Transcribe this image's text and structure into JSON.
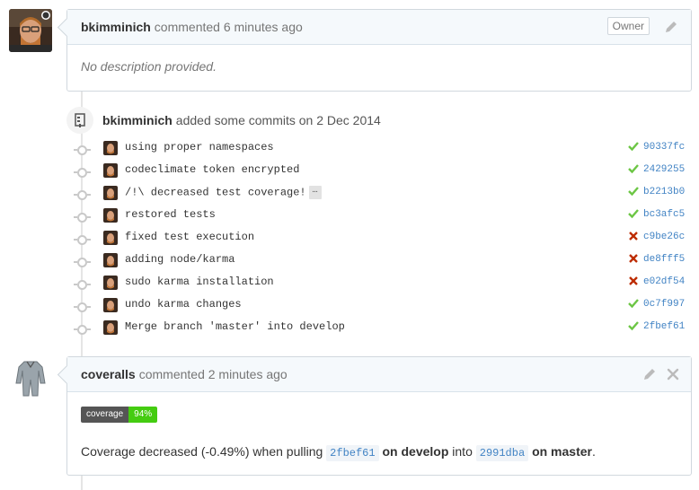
{
  "comment1": {
    "author": "bkimminich",
    "action": "commented 6 minutes ago",
    "badge": "Owner",
    "body": "No description provided."
  },
  "commits_header": {
    "author": "bkimminich",
    "action": "added some commits on 2 Dec 2014"
  },
  "commits": [
    {
      "message": "using proper namespaces",
      "sha": "90337fc",
      "status": "success"
    },
    {
      "message": "codeclimate token encrypted",
      "sha": "2429255",
      "status": "success"
    },
    {
      "message": "/!\\ decreased test coverage!",
      "sha": "b2213b0",
      "status": "success",
      "has_more": true
    },
    {
      "message": "restored tests",
      "sha": "bc3afc5",
      "status": "success"
    },
    {
      "message": "fixed test execution",
      "sha": "c9be26c",
      "status": "failure"
    },
    {
      "message": "adding node/karma",
      "sha": "de8fff5",
      "status": "failure"
    },
    {
      "message": "sudo karma installation",
      "sha": "e02df54",
      "status": "failure"
    },
    {
      "message": "undo karma changes",
      "sha": "0c7f997",
      "status": "success"
    },
    {
      "message": "Merge branch 'master' into develop",
      "sha": "2fbef61",
      "status": "success"
    }
  ],
  "ellipsis_label": "…",
  "comment2": {
    "author": "coveralls",
    "action": "commented 2 minutes ago",
    "badge_left": "coverage",
    "badge_right": "94%",
    "text_prefix": "Coverage decreased (-0.49%) when pulling",
    "head_sha": "2fbef61",
    "head_branch": "on develop",
    "into_text": "into",
    "base_sha": "2991dba",
    "base_branch": "on master",
    "suffix": "."
  },
  "colors": {
    "success": "#6cc644",
    "failure": "#bd2c00",
    "link": "#4183c4",
    "badge_green": "#44cc11"
  }
}
